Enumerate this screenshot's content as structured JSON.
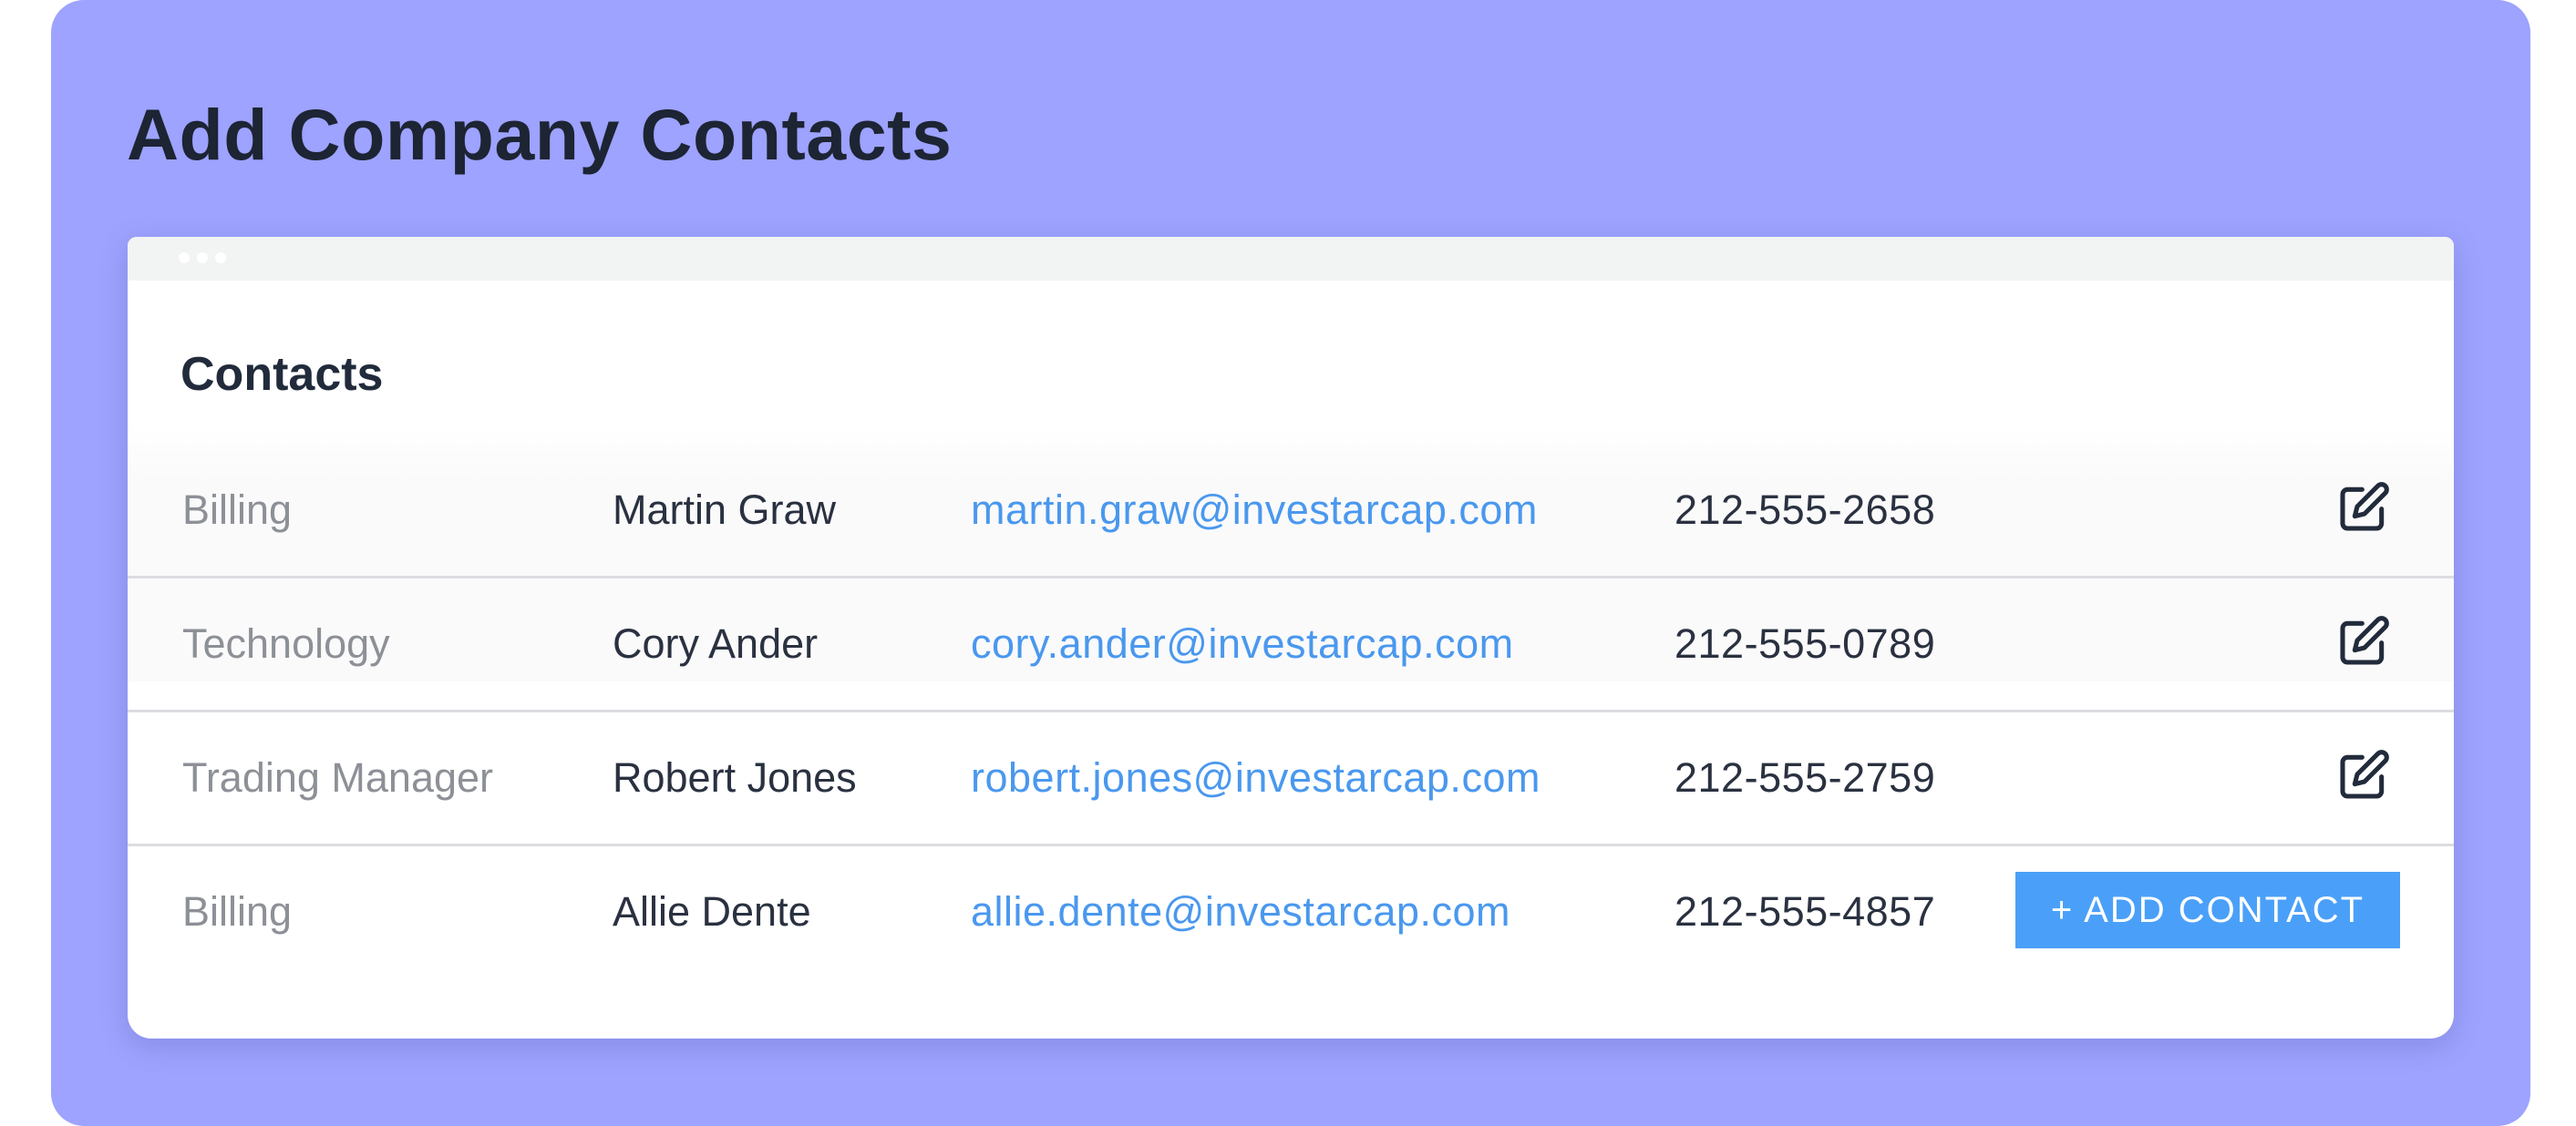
{
  "page": {
    "title": "Add Company Contacts"
  },
  "panel": {
    "title": "Contacts",
    "add_button_label": "+ ADD CONTACT"
  },
  "contacts": [
    {
      "department": "Billing",
      "name": "Martin Graw",
      "email": "martin.graw@investarcap.com",
      "phone": "212-555-2658"
    },
    {
      "department": "Technology",
      "name": "Cory Ander",
      "email": "cory.ander@investarcap.com",
      "phone": "212-555-0789"
    },
    {
      "department": "Trading Manager",
      "name": "Robert Jones",
      "email": "robert.jones@investarcap.com",
      "phone": "212-555-2759"
    },
    {
      "department": "Billing",
      "name": "Allie Dente",
      "email": "allie.dente@investarcap.com",
      "phone": "212-555-4857"
    }
  ],
  "icons": {
    "edit": "edit-icon"
  },
  "colors": {
    "background": "#9da3fe",
    "link": "#4a98ee",
    "button": "#4aa0f8",
    "heading": "#1d2433"
  }
}
